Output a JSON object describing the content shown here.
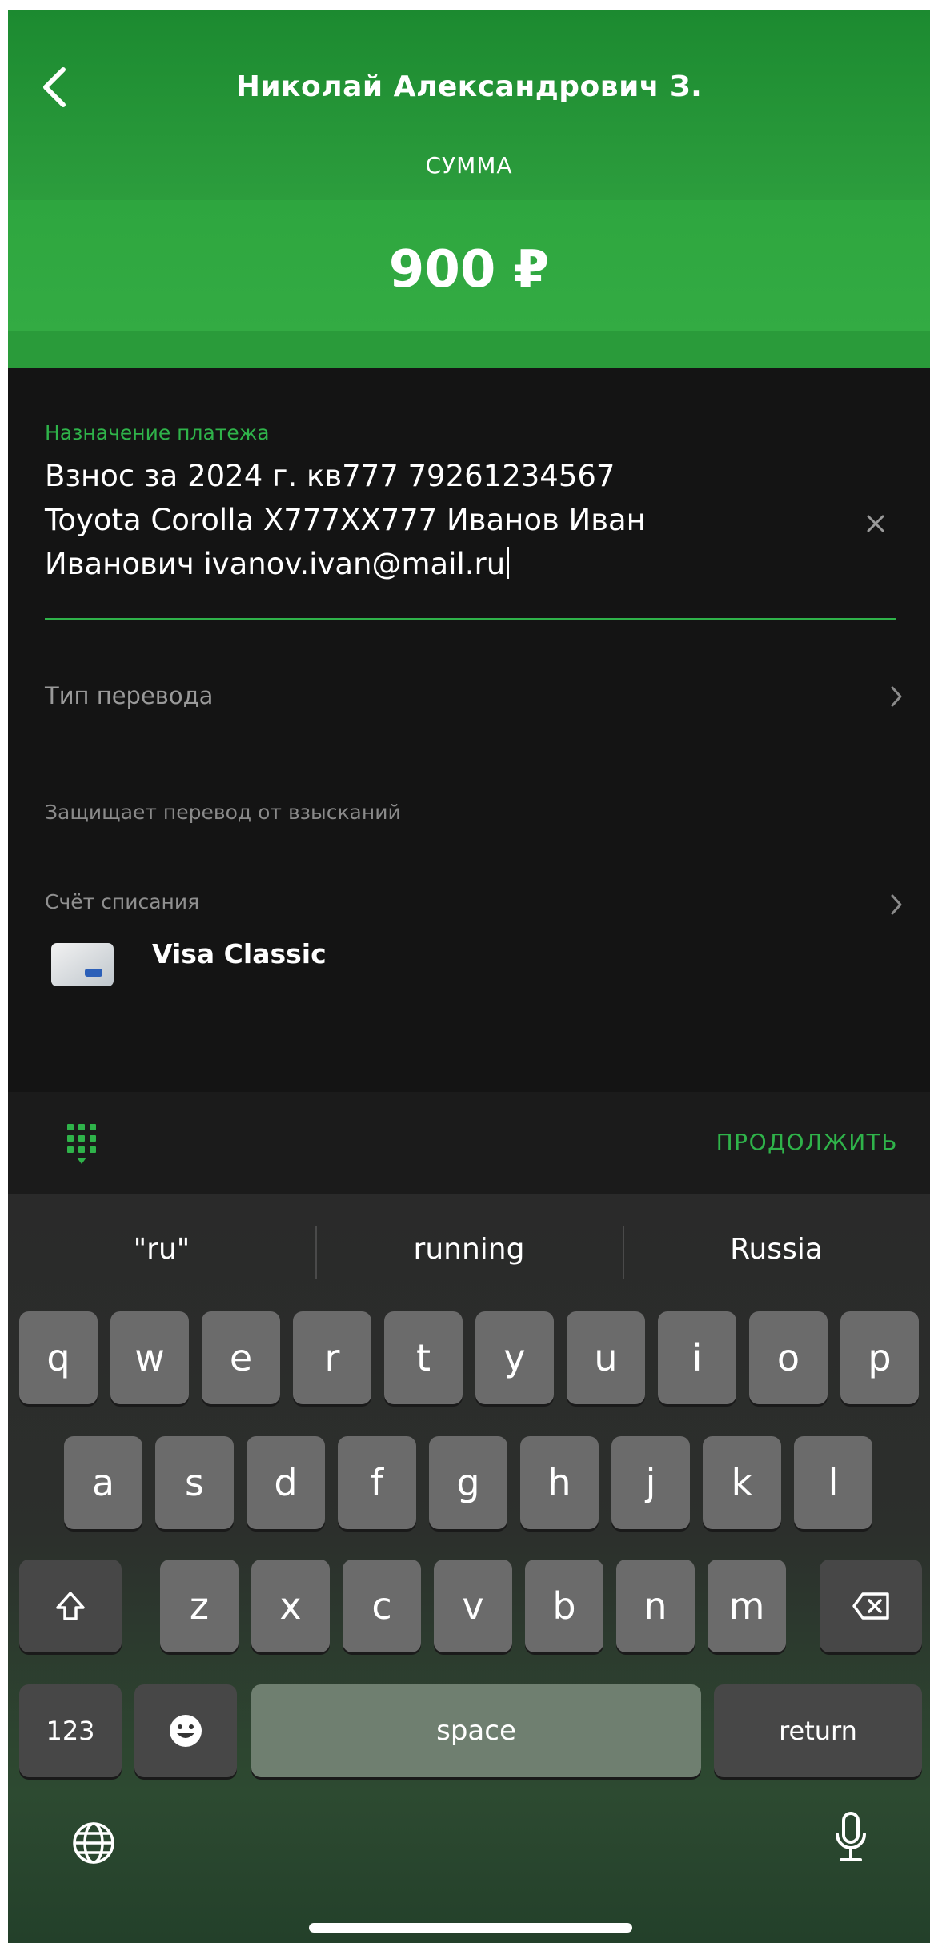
{
  "header": {
    "recipient": "Николай Александрович З.",
    "sum_label": "СУММА",
    "amount": "900 ₽"
  },
  "form": {
    "purpose_label": "Назначение платежа",
    "purpose_value": "Взнос за 2024 г. кв777 79261234567\nToyota Corolla X777XX777 Иванов Иван\nИванович ivanov.ivan@mail.ru",
    "transfer_type_label": "Тип перевода",
    "protect_text": "Защищает перевод от взысканий",
    "account_label": "Счёт списания",
    "account_name": "Visa Classic"
  },
  "toolbar": {
    "continue_label": "ПРОДОЛЖИТЬ"
  },
  "keyboard": {
    "suggestions": [
      "\"ru\"",
      "running",
      "Russia"
    ],
    "row1": [
      "q",
      "w",
      "e",
      "r",
      "t",
      "y",
      "u",
      "i",
      "o",
      "p"
    ],
    "row2": [
      "a",
      "s",
      "d",
      "f",
      "g",
      "h",
      "j",
      "k",
      "l"
    ],
    "row3": [
      "z",
      "x",
      "c",
      "v",
      "b",
      "n",
      "m"
    ],
    "numbers_label": "123",
    "space_label": "space",
    "return_label": "return"
  },
  "colors": {
    "accent_green": "#2fb34a",
    "header_green": "#2ea63f",
    "background": "#141414"
  }
}
